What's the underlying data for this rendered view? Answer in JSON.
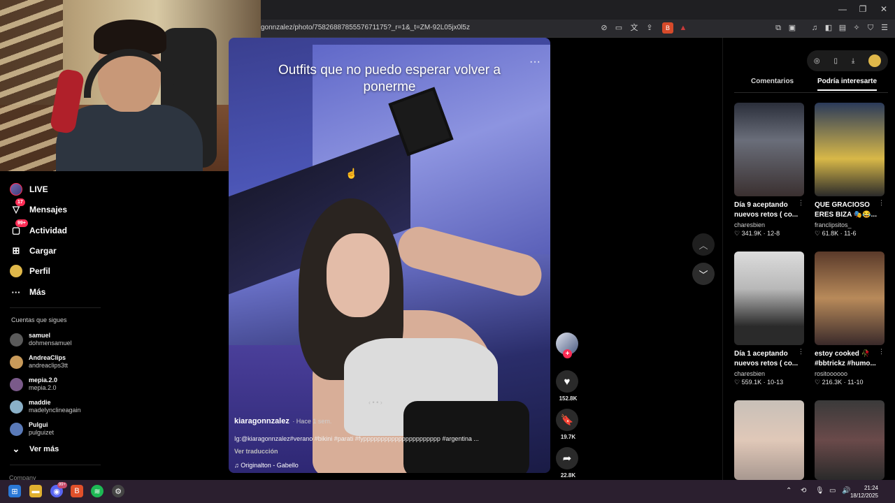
{
  "browser": {
    "url": "gonnzalez/photo/7582688785557671175?_r=1&_t=ZM-92L05jx0l5z",
    "window_controls": [
      "—",
      "❐",
      "✕"
    ]
  },
  "sidebar": {
    "items": [
      {
        "label": "LIVE",
        "icon": "live-icon"
      },
      {
        "label": "Mensajes",
        "icon": "message-icon",
        "badge": "17"
      },
      {
        "label": "Actividad",
        "icon": "activity-icon",
        "badge": "99+"
      },
      {
        "label": "Cargar",
        "icon": "upload-icon"
      },
      {
        "label": "Perfil",
        "icon": "profile-icon"
      },
      {
        "label": "Más",
        "icon": "more-icon"
      }
    ],
    "following_title": "Cuentas que sigues",
    "following": [
      {
        "name": "samuel",
        "user": "dohmensamuel",
        "color": "#5a5a5a"
      },
      {
        "name": "AndreaClips",
        "user": "andreaclips3tt",
        "color": "#c89a5a"
      },
      {
        "name": "mepia.2.0",
        "user": "mepia.2.0",
        "color": "#7a5a8a"
      },
      {
        "name": "maddie",
        "user": "madelynclineagain",
        "color": "#8ab0c8"
      },
      {
        "name": "Pulgui",
        "user": "pulguizet",
        "color": "#5a7ab8"
      }
    ],
    "see_more": "Ver más",
    "company": "Company"
  },
  "post": {
    "title": "Outfits que no puedo esperar volver a ponerme",
    "username": "kiaragonnzalez",
    "time": "· Hace 1 sem.",
    "description": "Ig:@kiaragonnzalez#verano #bikini #parati #fypppppppppppppppppppppp #argentina ...",
    "translate": "Ver traducción",
    "music": "Originalton - Gabello",
    "likes": "152.8K",
    "saves": "19.7K",
    "shares": "22.8K"
  },
  "right_panel": {
    "tabs": [
      "Comentarios",
      "Podría interesarte"
    ],
    "cards": [
      {
        "title": "Día 9 aceptando nuevos retos ( co...",
        "user": "charesbien",
        "likes": "341.9K",
        "date": "12-8",
        "bg": "linear-gradient(180deg,#2a2e3a,#6a6e7a 40%,#3a3030)"
      },
      {
        "title": "QUE GRACIOSO ERES BIZA 🎭😂...",
        "user": "franclipsitos_",
        "likes": "61.8K",
        "date": "11-6",
        "bg": "linear-gradient(180deg,#2a3a5a,#d8b848 60%,#2a2a2a)"
      },
      {
        "title": "Día 1 aceptando nuevos retos ( co...",
        "user": "charesbien",
        "likes": "559.1K",
        "date": "10-13",
        "bg": "linear-gradient(180deg,#dcdcdc,#b8b8b8 40%,#2a2a2a 80%)"
      },
      {
        "title": "estoy cooked 🥀 #bbtrickz #humo...",
        "user": "rositoooooo",
        "likes": "216.3K",
        "date": "11-10",
        "bg": "linear-gradient(180deg,#5a3a2a,#b88a5a 50%,#3a2a2a)"
      },
      {
        "title": "",
        "user": "",
        "likes": "",
        "date": "",
        "bg": "linear-gradient(180deg,#c8c0b8,#e0c8b8 50%,#a89890)"
      },
      {
        "title": "",
        "user": "",
        "likes": "",
        "date": "",
        "bg": "linear-gradient(180deg,#3a3a3a,#6a4a4a 50%,#2a2a2a)"
      }
    ]
  },
  "taskbar": {
    "time": "21:24",
    "date": "18/12/2025",
    "discord_badge": "99+"
  }
}
